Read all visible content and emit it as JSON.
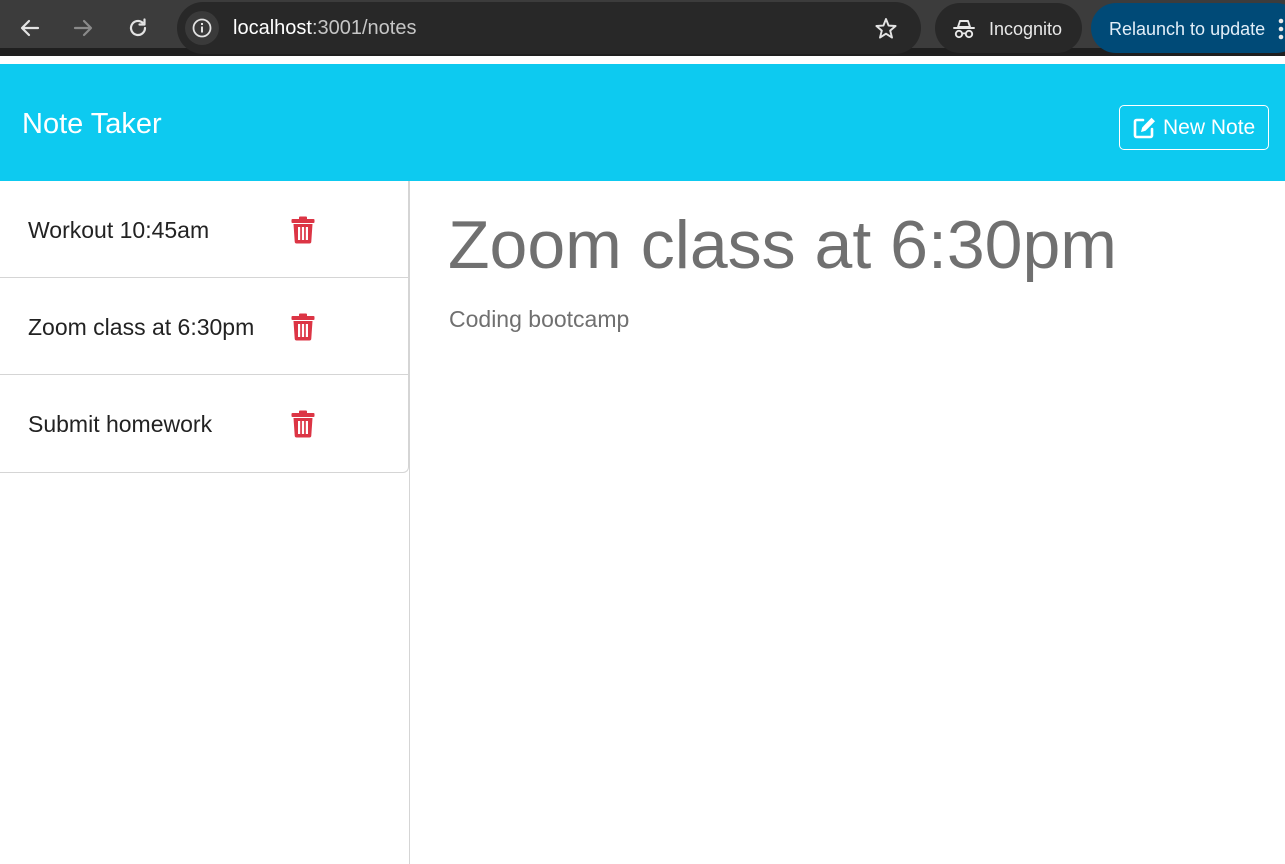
{
  "browser": {
    "url_host": "localhost",
    "url_rest": ":3001/notes",
    "incognito_label": "Incognito",
    "relaunch_label": "Relaunch to update"
  },
  "header": {
    "title": "Note Taker",
    "new_note_label": "New Note"
  },
  "notes": [
    {
      "title": "Workout 10:45am"
    },
    {
      "title": "Zoom class at 6:30pm"
    },
    {
      "title": "Submit homework"
    }
  ],
  "active_note": {
    "title": "Zoom class at 6:30pm",
    "text": "Coding bootcamp"
  },
  "colors": {
    "header_bg": "#0dcaf0",
    "delete_red": "#dc3545",
    "note_text": "#707070",
    "browser_bg": "#3c3c3c",
    "relaunch_bg": "#004a77"
  },
  "icons": {
    "back": "arrow-left-icon",
    "forward": "arrow-right-icon",
    "reload": "reload-icon",
    "site_info": "info-icon",
    "bookmark": "star-icon",
    "incognito": "incognito-icon",
    "menu": "kebab-menu-icon",
    "new_note": "pen-to-square-icon",
    "delete": "trash-icon"
  }
}
